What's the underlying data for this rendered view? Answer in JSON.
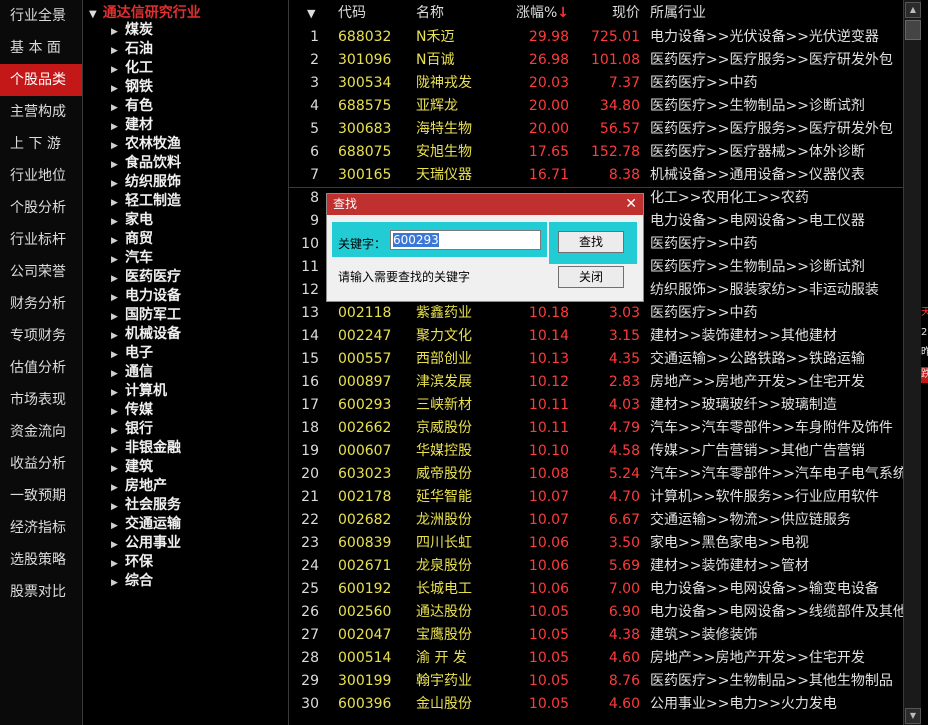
{
  "left_nav": {
    "items": [
      "行业全景",
      "基 本 面",
      "个股品类",
      "主营构成",
      "上 下 游",
      "行业地位",
      "个股分析",
      "行业标杆",
      "公司荣誉",
      "财务分析",
      "专项财务",
      "估值分析",
      "市场表现",
      "资金流向",
      "收益分析",
      "一致预期",
      "经济指标",
      "选股策略",
      "股票对比"
    ],
    "active_index": 2
  },
  "tree": {
    "root_label": "通达信研究行业",
    "nodes": [
      "煤炭",
      "石油",
      "化工",
      "钢铁",
      "有色",
      "建材",
      "农林牧渔",
      "食品饮料",
      "纺织服饰",
      "轻工制造",
      "家电",
      "商贸",
      "汽车",
      "医药医疗",
      "电力设备",
      "国防军工",
      "机械设备",
      "电子",
      "通信",
      "计算机",
      "传媒",
      "银行",
      "非银金融",
      "建筑",
      "房地产",
      "社会服务",
      "交通运输",
      "公用事业",
      "环保",
      "综合"
    ]
  },
  "table": {
    "headers": {
      "code": "代码",
      "name": "名称",
      "change": "涨幅%",
      "sort_arrow": "↓",
      "price": "现价",
      "industry": "所属行业"
    },
    "rows": [
      {
        "seq": "1",
        "code": "688032",
        "name": "N禾迈",
        "change": "29.98",
        "price": "725.01",
        "industry": "电力设备>>光伏设备>>光伏逆变器"
      },
      {
        "seq": "2",
        "code": "301096",
        "name": "N百诚",
        "change": "26.98",
        "price": "101.08",
        "industry": "医药医疗>>医疗服务>>医疗研发外包"
      },
      {
        "seq": "3",
        "code": "300534",
        "name": "陇神戎发",
        "change": "20.03",
        "price": "7.37",
        "industry": "医药医疗>>中药"
      },
      {
        "seq": "4",
        "code": "688575",
        "name": "亚辉龙",
        "change": "20.00",
        "price": "34.80",
        "industry": "医药医疗>>生物制品>>诊断试剂"
      },
      {
        "seq": "5",
        "code": "300683",
        "name": "海特生物",
        "change": "20.00",
        "price": "56.57",
        "industry": "医药医疗>>医疗服务>>医疗研发外包"
      },
      {
        "seq": "6",
        "code": "688075",
        "name": "安旭生物",
        "change": "17.65",
        "price": "152.78",
        "industry": "医药医疗>>医疗器械>>体外诊断"
      },
      {
        "seq": "7",
        "code": "300165",
        "name": "天瑞仪器",
        "change": "16.71",
        "price": "8.38",
        "industry": "机械设备>>通用设备>>仪器仪表"
      },
      {
        "seq": "8",
        "code": "",
        "name": "",
        "change": "",
        "price": "",
        "industry": "化工>>农用化工>>农药"
      },
      {
        "seq": "9",
        "code": "",
        "name": "",
        "change": "",
        "price": "",
        "industry": "电力设备>>电网设备>>电工仪器"
      },
      {
        "seq": "10",
        "code": "",
        "name": "",
        "change": "",
        "price": "",
        "industry": "医药医疗>>中药"
      },
      {
        "seq": "11",
        "code": "",
        "name": "",
        "change": "",
        "price": "",
        "industry": "医药医疗>>生物制品>>诊断试剂"
      },
      {
        "seq": "12",
        "code": "",
        "name": "",
        "change": "",
        "price": "",
        "industry": "纺织服饰>>服装家纺>>非运动服装"
      },
      {
        "seq": "13",
        "code": "002118",
        "name": "紫鑫药业",
        "change": "10.18",
        "price": "3.03",
        "industry": "医药医疗>>中药"
      },
      {
        "seq": "14",
        "code": "002247",
        "name": "聚力文化",
        "change": "10.14",
        "price": "3.15",
        "industry": "建材>>装饰建材>>其他建材"
      },
      {
        "seq": "15",
        "code": "000557",
        "name": "西部创业",
        "change": "10.13",
        "price": "4.35",
        "industry": "交通运输>>公路铁路>>铁路运输"
      },
      {
        "seq": "16",
        "code": "000897",
        "name": "津滨发展",
        "change": "10.12",
        "price": "2.83",
        "industry": "房地产>>房地产开发>>住宅开发"
      },
      {
        "seq": "17",
        "code": "600293",
        "name": "三峡新材",
        "change": "10.11",
        "price": "4.03",
        "industry": "建材>>玻璃玻纤>>玻璃制造"
      },
      {
        "seq": "18",
        "code": "002662",
        "name": "京威股份",
        "change": "10.11",
        "price": "4.79",
        "industry": "汽车>>汽车零部件>>车身附件及饰件"
      },
      {
        "seq": "19",
        "code": "000607",
        "name": "华媒控股",
        "change": "10.10",
        "price": "4.58",
        "industry": "传媒>>广告营销>>其他广告营销"
      },
      {
        "seq": "20",
        "code": "603023",
        "name": "威帝股份",
        "change": "10.08",
        "price": "5.24",
        "industry": "汽车>>汽车零部件>>汽车电子电气系统"
      },
      {
        "seq": "21",
        "code": "002178",
        "name": "延华智能",
        "change": "10.07",
        "price": "4.70",
        "industry": "计算机>>软件服务>>行业应用软件"
      },
      {
        "seq": "22",
        "code": "002682",
        "name": "龙洲股份",
        "change": "10.07",
        "price": "6.67",
        "industry": "交通运输>>物流>>供应链服务"
      },
      {
        "seq": "23",
        "code": "600839",
        "name": "四川长虹",
        "change": "10.06",
        "price": "3.50",
        "industry": "家电>>黑色家电>>电视"
      },
      {
        "seq": "24",
        "code": "002671",
        "name": "龙泉股份",
        "change": "10.06",
        "price": "5.69",
        "industry": "建材>>装饰建材>>管材"
      },
      {
        "seq": "25",
        "code": "600192",
        "name": "长城电工",
        "change": "10.06",
        "price": "7.00",
        "industry": "电力设备>>电网设备>>输变电设备"
      },
      {
        "seq": "26",
        "code": "002560",
        "name": "通达股份",
        "change": "10.05",
        "price": "6.90",
        "industry": "电力设备>>电网设备>>线缆部件及其他"
      },
      {
        "seq": "27",
        "code": "002047",
        "name": "宝鹰股份",
        "change": "10.05",
        "price": "4.38",
        "industry": "建筑>>装修装饰"
      },
      {
        "seq": "28",
        "code": "000514",
        "name": "渝 开 发",
        "change": "10.05",
        "price": "4.60",
        "industry": "房地产>>房地产开发>>住宅开发"
      },
      {
        "seq": "29",
        "code": "300199",
        "name": "翰宇药业",
        "change": "10.05",
        "price": "8.76",
        "industry": "医药医疗>>生物制品>>其他生物制品"
      },
      {
        "seq": "30",
        "code": "600396",
        "name": "金山股份",
        "change": "10.05",
        "price": "4.60",
        "industry": "公用事业>>电力>>火力发电"
      }
    ]
  },
  "dialog": {
    "title": "查找",
    "keyword_label": "关键字：",
    "keyword_value": "600293",
    "find_button": "查找",
    "close_button": "关闭",
    "hint": "请输入需要查找的关键字"
  },
  "right_strip": [
    "天",
    "2",
    "昨",
    "跌"
  ],
  "colors": {
    "up_red": "#ff3b3b",
    "code_yellow": "#e8e050",
    "active_nav": "#c41818",
    "dialog_title": "#c0302e",
    "dialog_highlight": "#22ccd4"
  }
}
